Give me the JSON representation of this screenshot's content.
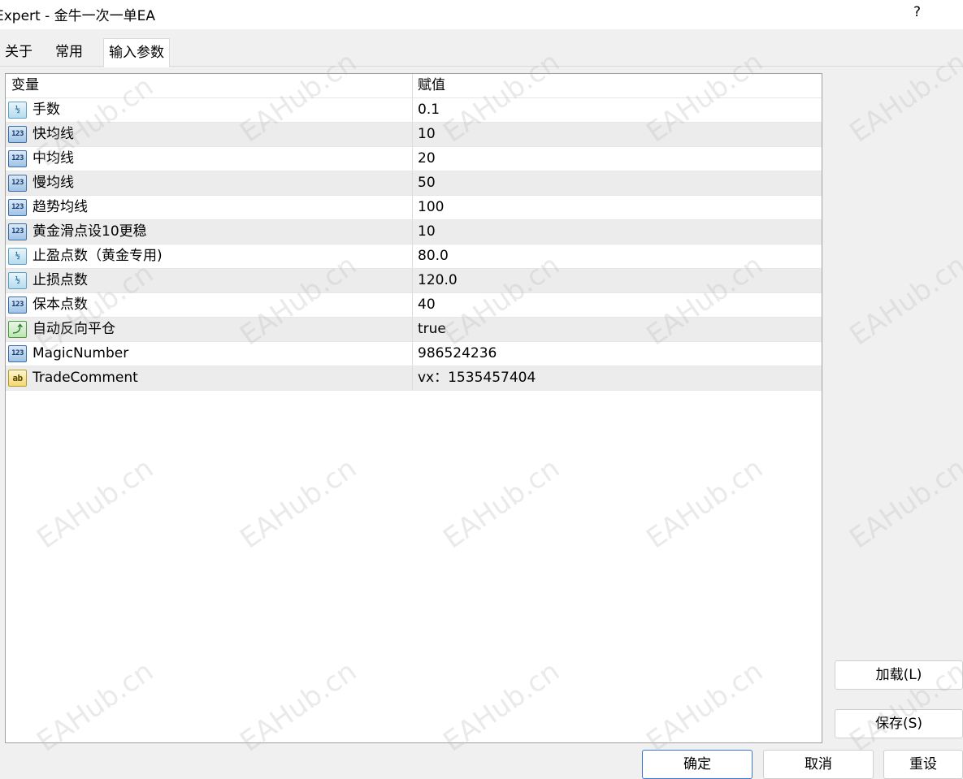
{
  "window": {
    "title": "Expert - 金牛一次一单EA",
    "help_label": "?"
  },
  "tabs": [
    {
      "label": "关于"
    },
    {
      "label": "常用"
    },
    {
      "label": "输入参数"
    }
  ],
  "table": {
    "headers": {
      "name": "变量",
      "value": "赋值"
    },
    "rows": [
      {
        "icon": "double-value-icon",
        "name": "手数",
        "value": "0.1"
      },
      {
        "icon": "integer-value-icon",
        "name": "快均线",
        "value": "10"
      },
      {
        "icon": "integer-value-icon",
        "name": "中均线",
        "value": "20"
      },
      {
        "icon": "integer-value-icon",
        "name": "慢均线",
        "value": "50"
      },
      {
        "icon": "integer-value-icon",
        "name": "趋势均线",
        "value": "100"
      },
      {
        "icon": "integer-value-icon",
        "name": "黄金滑点设10更稳",
        "value": "10"
      },
      {
        "icon": "double-value-icon",
        "name": "止盈点数（黄金专用)",
        "value": "80.0"
      },
      {
        "icon": "double-value-icon",
        "name": "止损点数",
        "value": "120.0"
      },
      {
        "icon": "integer-value-icon",
        "name": "保本点数",
        "value": "40"
      },
      {
        "icon": "boolean-value-icon",
        "name": "自动反向平仓",
        "value": "true"
      },
      {
        "icon": "integer-value-icon",
        "name": "MagicNumber",
        "value": "986524236"
      },
      {
        "icon": "string-value-icon",
        "name": "TradeComment",
        "value": "vx：1535457404"
      }
    ]
  },
  "buttons": {
    "load": "加载(L)",
    "save": "保存(S)",
    "ok": "确定",
    "cancel": "取消",
    "reset": "重设"
  },
  "icon_glyphs": {
    "integer": "123",
    "double": "½",
    "boolean": "⤴",
    "string": "ab"
  },
  "watermark": "EAHub.cn",
  "colors": {
    "row_alt": "#ececec",
    "primary_border": "#3a78d6"
  }
}
